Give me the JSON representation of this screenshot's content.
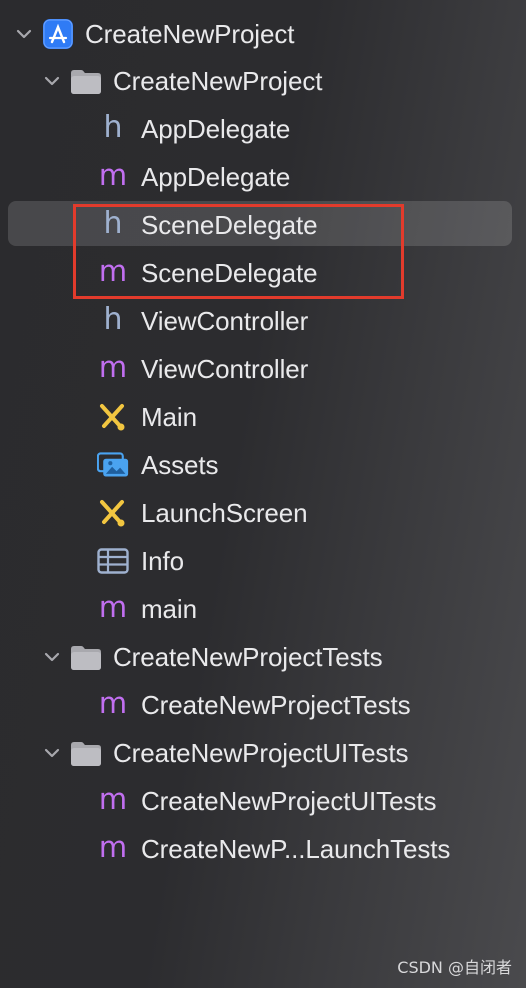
{
  "tree": {
    "root": {
      "label": "CreateNewProject",
      "icon": "xcode-project-icon"
    },
    "groups": [
      {
        "label": "CreateNewProject",
        "icon": "folder-icon",
        "items": [
          {
            "label": "AppDelegate",
            "type": "h"
          },
          {
            "label": "AppDelegate",
            "type": "m"
          },
          {
            "label": "SceneDelegate",
            "type": "h"
          },
          {
            "label": "SceneDelegate",
            "type": "m"
          },
          {
            "label": "ViewController",
            "type": "h"
          },
          {
            "label": "ViewController",
            "type": "m"
          },
          {
            "label": "Main",
            "type": "storyboard"
          },
          {
            "label": "Assets",
            "type": "assets"
          },
          {
            "label": "LaunchScreen",
            "type": "storyboard"
          },
          {
            "label": "Info",
            "type": "plist"
          },
          {
            "label": "main",
            "type": "m"
          }
        ]
      },
      {
        "label": "CreateNewProjectTests",
        "icon": "folder-icon",
        "items": [
          {
            "label": "CreateNewProjectTests",
            "type": "m"
          }
        ]
      },
      {
        "label": "CreateNewProjectUITests",
        "icon": "folder-icon",
        "items": [
          {
            "label": "CreateNewProjectUITests",
            "type": "m"
          },
          {
            "label": "CreateNewP...LaunchTests",
            "type": "m"
          }
        ]
      }
    ]
  },
  "glyphs": {
    "h": "h",
    "m": "m"
  },
  "watermark": "CSDN @自闭者",
  "colors": {
    "header_icon": "#9fb1cf",
    "impl_icon": "#c16ff0",
    "storyboard_icon": "#f2c640",
    "assets_icon": "#4aa3f0",
    "highlight_border": "#e23b2c",
    "project_icon": "#2f7bf5"
  }
}
